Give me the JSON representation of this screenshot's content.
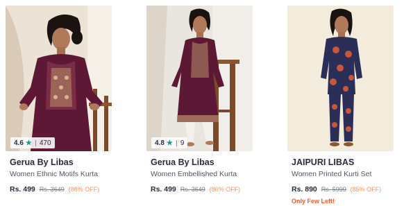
{
  "products": [
    {
      "brand": "Gerua By Libas",
      "title": "Women Ethnic Motifs Kurta",
      "price": "Rs. 499",
      "mrp": "Rs. 3649",
      "discount": "(86% OFF)",
      "rating": "4.6",
      "rating_count": "470",
      "rating_icon": "star-icon",
      "colors": {
        "garment": "#5c1834",
        "embroidery": "#b89068",
        "background": "#ece3d6"
      }
    },
    {
      "brand": "Gerua By Libas",
      "title": "Women Embellished Kurta",
      "price": "Rs. 499",
      "mrp": "Rs. 3649",
      "discount": "(86% OFF)",
      "rating": "4.8",
      "rating_count": "9",
      "rating_icon": "star-icon",
      "colors": {
        "garment": "#5c1834",
        "embroidery": "#b89068",
        "background": "#e9e5df"
      }
    },
    {
      "brand": "JAIPURI LIBAS",
      "title": "Women Printed Kurti Set",
      "price": "Rs. 890",
      "mrp": "Rs. 5999",
      "discount": "(85% OFF)",
      "urgency": "Only Few Left!",
      "colors": {
        "garment": "#2b2f58",
        "print": "#c8563c",
        "background": "#f3ecdc"
      }
    }
  ],
  "theme": {
    "rating_star": "#14958f",
    "discount": "#ff905a",
    "urgency": "#ff5722"
  }
}
